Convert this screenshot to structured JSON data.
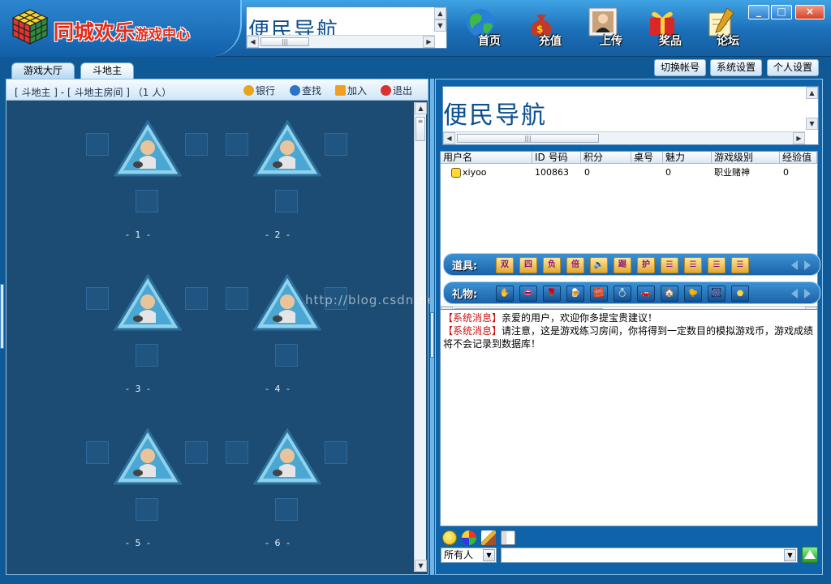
{
  "window": {
    "title_main": "同城欢乐",
    "title_sub": "游戏中心",
    "banner_text": "便民导航",
    "nav": [
      {
        "label": "首页",
        "icon": "globe-icon"
      },
      {
        "label": "充值",
        "icon": "money-bag-icon"
      },
      {
        "label": "上传",
        "icon": "photo-icon"
      },
      {
        "label": "奖品",
        "icon": "gift-icon"
      },
      {
        "label": "论坛",
        "icon": "pen-icon"
      }
    ],
    "controls": {
      "minimize": "_",
      "maximize": "□",
      "close": "×"
    }
  },
  "tabs": [
    {
      "label": "游戏大厅",
      "active": false
    },
    {
      "label": "斗地主",
      "active": true
    }
  ],
  "top_buttons": [
    "切换帐号",
    "系统设置",
    "个人设置"
  ],
  "room": {
    "path": "[ 斗地主 ] - [ 斗地主房间 ] （1 人）",
    "actions": [
      {
        "label": "银行",
        "icon": "bank-icon",
        "color": "#e8a41c"
      },
      {
        "label": "查找",
        "icon": "magnifier-icon",
        "color": "#2e73c7"
      },
      {
        "label": "加入",
        "icon": "arrow-right-icon",
        "color": "#f0a020"
      },
      {
        "label": "退出",
        "icon": "exit-icon",
        "color": "#d93030"
      }
    ],
    "tables": [
      "- 1 -",
      "- 2 -",
      "- 3 -",
      "- 4 -",
      "- 5 -",
      "- 6 -"
    ],
    "watermark": "http://blog.csdn.net/"
  },
  "right": {
    "banner_text": "便民导航",
    "user_columns": [
      "用户名",
      "ID 号码",
      "积分",
      "桌号",
      "魅力",
      "游戏级别",
      "经验值"
    ],
    "users": [
      {
        "name": "xiyoo",
        "id": "100863",
        "score": "0",
        "table": "",
        "charm": "0",
        "level": "职业赌神",
        "exp": "0"
      }
    ],
    "props_label": "道具:",
    "props": [
      "双",
      "四",
      "负",
      "倍",
      "🔈",
      "踢",
      "护",
      "☰",
      "☰",
      "☰",
      "☰"
    ],
    "gifts_label": "礼物:",
    "gifts": [
      "✋",
      "👄",
      "🌹",
      "🍺",
      "🧱",
      "💍",
      "🚗",
      "🏠",
      "🐤",
      "🎆",
      "●"
    ],
    "messages": [
      {
        "tag": "【系统消息】",
        "text": "亲爱的用户，欢迎你多提宝贵建议！"
      },
      {
        "tag": "【系统消息】",
        "text": "请注意，这是游戏练习房间，你将得到一定数目的模拟游戏币，游戏成绩将不会记录到数据库！"
      }
    ],
    "chat_target": "所有人",
    "chat_input": ""
  },
  "colors": {
    "accent_blue": "#1b6fb8",
    "title_red": "#e32b1a",
    "system_red": "#c81414"
  }
}
